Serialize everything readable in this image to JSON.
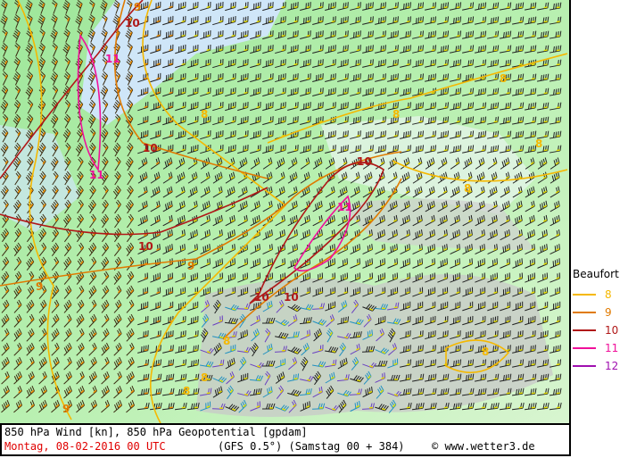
{
  "title": "850 hPa Wind [kn], 850 hPa Geopotential [gpdam]",
  "valid_time": "Montag, 08-02-2016   00 UTC",
  "model_run": "(GFS 0.5°)  (Samstag 00 + 384)",
  "credit": "© www.wetter3.de",
  "legend": {
    "title": "Beaufort",
    "items": [
      {
        "label": "8",
        "color": "#f5b800"
      },
      {
        "label": "9",
        "color": "#e07a00"
      },
      {
        "label": "10",
        "color": "#b01818"
      },
      {
        "label": "11",
        "color": "#f0109a"
      },
      {
        "label": "12",
        "color": "#a010b0"
      }
    ]
  },
  "contour_labels": [
    "10",
    "9",
    "11",
    "11",
    "10",
    "8",
    "10",
    "10",
    "11",
    "10",
    "10",
    "9",
    "9",
    "8",
    "8",
    "8",
    "8",
    "8",
    "8",
    "9",
    "8",
    "8"
  ]
}
